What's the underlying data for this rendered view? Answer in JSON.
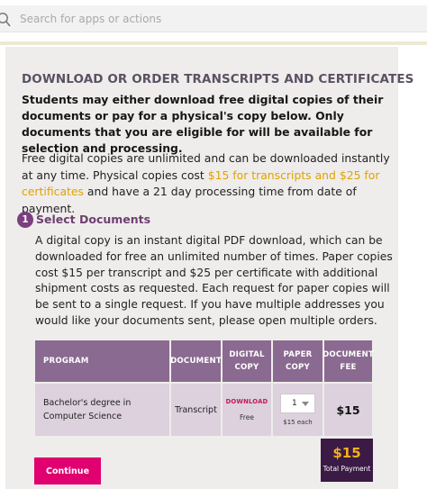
{
  "search": {
    "placeholder": "Search for apps or actions"
  },
  "page": {
    "title": "DOWNLOAD OR ORDER TRANSCRIPTS AND CERTIFICATES",
    "intro_bold": "Students may either download free digital copies of their documents or pay for a physical's copy below. Only documents that you are eligible for will be available for selection and processing.",
    "intro_before": "Free digital copies are unlimited and can be downloaded instantly at any time. Physical copies cost ",
    "intro_highlight": "$15 for transcripts and $25 for certificates",
    "intro_after": " and have a 21 day processing time from date of payment."
  },
  "step": {
    "number": "1",
    "title": "Select Documents",
    "description": "A digital copy is an instant digital PDF download, which can be downloaded for free an unlimited number of times. Paper copies cost $15 per transcript and $25 per certificate with additional shipment costs as requested. Each request for paper copies will be sent to a single request. If you have multiple addresses you would like your documents sent, please open multiple orders."
  },
  "table": {
    "headers": {
      "program": "PROGRAM",
      "document": "DOCUMENT",
      "digital_copy": "DIGITAL COPY",
      "paper_copy": "PAPER COPY",
      "document_fee": "DOCUMENT FEE"
    },
    "rows": [
      {
        "program": "Bachelor's degree in Computer Science",
        "document": "Transcript",
        "download_label": "DOWNLOAD",
        "free_label": "Free",
        "quantity": "1",
        "each_label": "$15 each",
        "fee": "$15"
      }
    ]
  },
  "total": {
    "amount": "$15",
    "label": "Total Payment"
  },
  "actions": {
    "continue_label": "Continue"
  },
  "colors": {
    "accent_purple": "#8a6a90",
    "dark_purple": "#3b1a45",
    "highlight_gold": "#e0a100",
    "continue_pink": "#e0006f",
    "download_pink": "#c2175b"
  }
}
